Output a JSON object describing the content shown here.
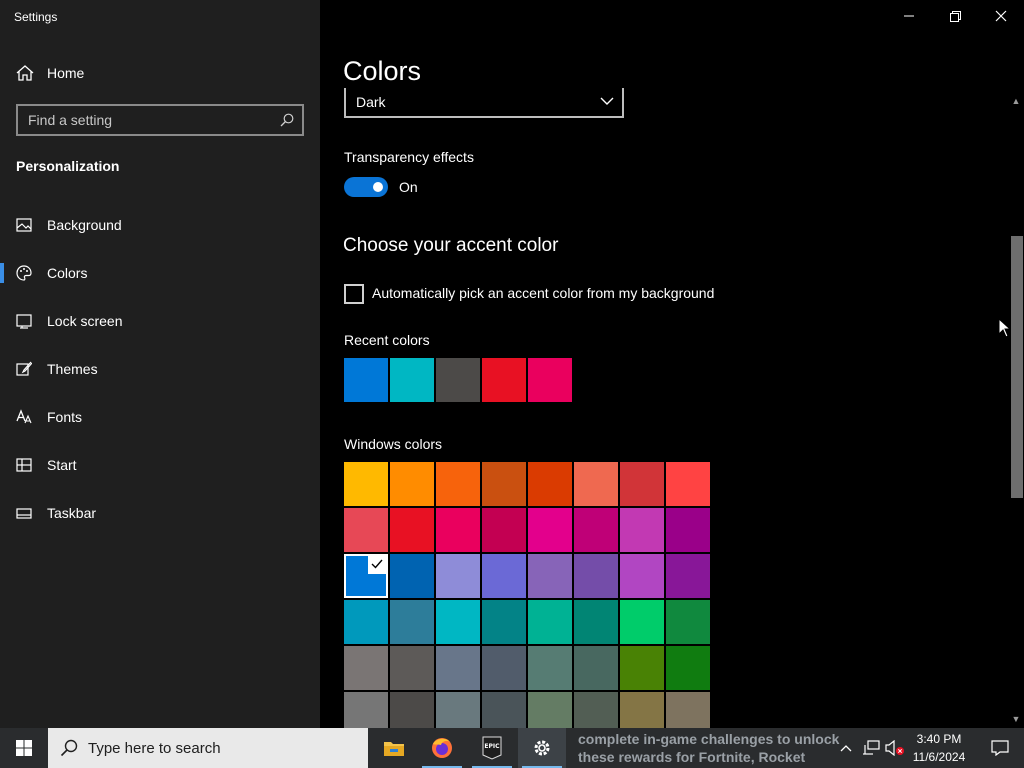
{
  "window": {
    "title": "Settings"
  },
  "sidebar": {
    "home_label": "Home",
    "search_placeholder": "Find a setting",
    "section_title": "Personalization",
    "items": [
      {
        "label": "Background",
        "icon": "picture-icon"
      },
      {
        "label": "Colors",
        "icon": "palette-icon",
        "active": true
      },
      {
        "label": "Lock screen",
        "icon": "lock-screen-icon"
      },
      {
        "label": "Themes",
        "icon": "brush-icon"
      },
      {
        "label": "Fonts",
        "icon": "fonts-icon"
      },
      {
        "label": "Start",
        "icon": "start-icon"
      },
      {
        "label": "Taskbar",
        "icon": "taskbar-icon"
      }
    ]
  },
  "main": {
    "title": "Colors",
    "mode_value": "Dark",
    "transparency": {
      "label": "Transparency effects",
      "state": "On",
      "on": true
    },
    "accent_heading": "Choose your accent color",
    "auto_pick_label": "Automatically pick an accent color from my background",
    "auto_pick_checked": false,
    "recent_label": "Recent colors",
    "recent_colors": [
      "#0078d7",
      "#00b7c3",
      "#4c4a48",
      "#e81123",
      "#ea005e"
    ],
    "windows_label": "Windows colors",
    "selected_color": "#0078d7",
    "windows_colors": [
      "#ffb900",
      "#ff8c00",
      "#f7630c",
      "#ca5010",
      "#da3b01",
      "#ef6950",
      "#d13438",
      "#ff4343",
      "#e74856",
      "#e81123",
      "#ea005e",
      "#c30052",
      "#e3008c",
      "#bf0077",
      "#c239b3",
      "#9a0089",
      "#0078d7",
      "#0063b1",
      "#8e8cd8",
      "#6b69d6",
      "#8764b8",
      "#744da9",
      "#b146c2",
      "#881798",
      "#0099bc",
      "#2d7d9a",
      "#00b7c3",
      "#038387",
      "#00b294",
      "#018574",
      "#00cc6a",
      "#10893e",
      "#7a7574",
      "#5d5a58",
      "#68768a",
      "#515c6b",
      "#567c73",
      "#486860",
      "#498205",
      "#107c10",
      "#767676",
      "#4c4a48",
      "#69797e",
      "#4a5459",
      "#647c64",
      "#525e54",
      "#847545",
      "#7e735f"
    ]
  },
  "taskbar": {
    "search_placeholder": "Type here to search",
    "apps": [
      {
        "name": "file-explorer",
        "icon": "folder-icon"
      },
      {
        "name": "firefox",
        "icon": "firefox-icon"
      },
      {
        "name": "epic-games",
        "icon": "epic-games-icon",
        "text": "EPIC"
      },
      {
        "name": "settings",
        "icon": "gear-icon",
        "active": true
      }
    ],
    "news_text": "complete in-game challenges to unlock these rewards for Fortnite, Rocket League...",
    "time": "3:40 PM",
    "date": "11/6/2024"
  },
  "colors": {
    "accent": "#0a74d6",
    "sidebar_bg": "#1f1f1f",
    "main_bg": "#000000",
    "taskbar_bg": "#2a2c2e"
  }
}
